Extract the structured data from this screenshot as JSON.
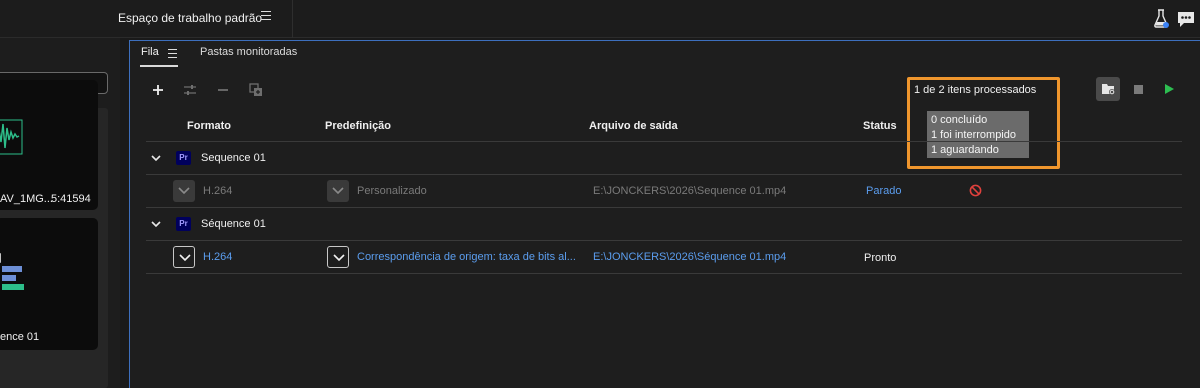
{
  "header": {
    "workspace": "Espaço de trabalho padrão"
  },
  "left_panel": {
    "item1_name": "AV_1MG...",
    "item1_duration": "5:41594",
    "item2_name": "ence 01"
  },
  "tabs": [
    {
      "label": "Fila"
    },
    {
      "label": "Pastas monitoradas"
    }
  ],
  "progress": {
    "text": "1 de 2 itens processados",
    "tooltip": [
      "0 concluído",
      "1 foi interrompido",
      "1 aguardando"
    ]
  },
  "columns": {
    "formato": "Formato",
    "predefinicao": "Predefinição",
    "arquivo": "Arquivo de saída",
    "status": "Status"
  },
  "groups": [
    {
      "badge": "Pr",
      "title": "Sequence 01",
      "format": "H.264",
      "preset": "Personalizado",
      "output": "E:\\JONCKERS\\2026\\Sequence 01.mp4",
      "status": "Parado"
    },
    {
      "badge": "Pr",
      "title": "Séquence 01",
      "format": "H.264",
      "preset": "Correspondência de origem: taxa de bits al...",
      "output": "E:\\JONCKERS\\2026\\Séquence 01.mp4",
      "status": "Pronto"
    }
  ],
  "colors": {
    "accent_blue": "#5b9dee",
    "highlight_orange": "#f0962d",
    "play_green": "#2dbe51",
    "stop_red": "#e0413d",
    "pr_badge_bg": "#00005c"
  },
  "icons": [
    "menu-icon",
    "flask-icon",
    "chat-icon",
    "plus-icon",
    "settings-sliders-icon",
    "minus-icon",
    "duplicate-icon",
    "chevron-down-icon",
    "folder-settings-icon",
    "stop-icon",
    "play-icon",
    "no-entry-icon"
  ]
}
